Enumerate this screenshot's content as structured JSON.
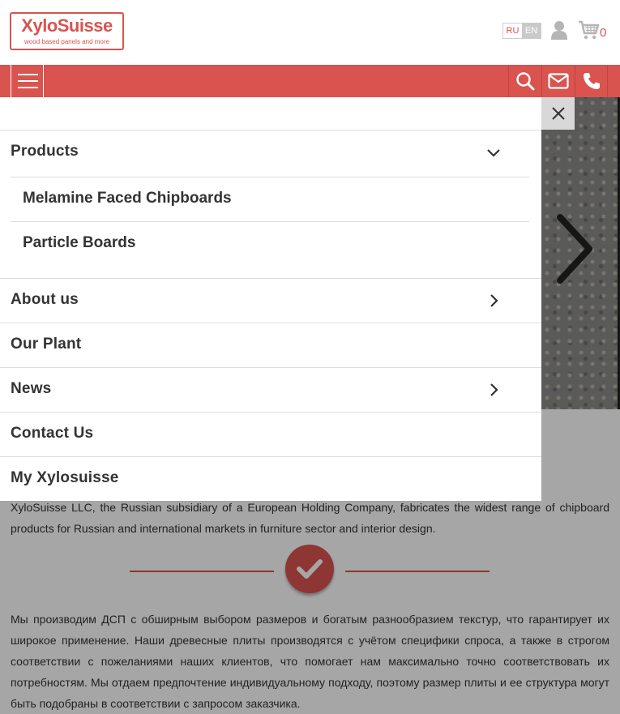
{
  "header": {
    "logo_title": "XyloSuisse",
    "logo_subtitle": "wood based panels and more",
    "lang_ru": "RU",
    "lang_en": "EN",
    "cart_count": "0"
  },
  "nav": {
    "icons": [
      "menu-icon",
      "search-icon",
      "envelope-icon",
      "phone-icon"
    ]
  },
  "menu": {
    "items": [
      {
        "label": "Products",
        "expanded": true,
        "icon": "chevron-down-icon"
      },
      {
        "label": "About us",
        "icon": "chevron-right-icon"
      },
      {
        "label": "Our Plant"
      },
      {
        "label": "News",
        "icon": "chevron-right-icon"
      },
      {
        "label": "Contact Us"
      },
      {
        "label": "My Xylosuisse"
      }
    ],
    "submenu": [
      {
        "label": "Melamine Faced Chipboards"
      },
      {
        "label": "Particle Boards"
      }
    ]
  },
  "content": {
    "intro": "XyloSuisse LLC, the Russian subsidiary of a European Holding Company, fabricates the widest range of chipboard products for Russian and international markets in furniture sector and interior design.",
    "ru_text": "Мы производим ДСП с обширным выбором размеров и богатым разнообразием текстур, что гарантирует их широкое применение. Наши древесные плиты производятся с учётом специфики спроса, а также в строгом соответствии с пожеланиями наших клиентов, что помогает нам максимально точно соответствовать их потребностям. Мы отдаем предпочтение индивидуальному подходу, поэтому размер плиты и ее структура могут быть подобраны в соответствии с запросом заказчика."
  },
  "colors": {
    "accent": "#d9534f",
    "overlay": "rgba(0,0,0,0.35)"
  }
}
